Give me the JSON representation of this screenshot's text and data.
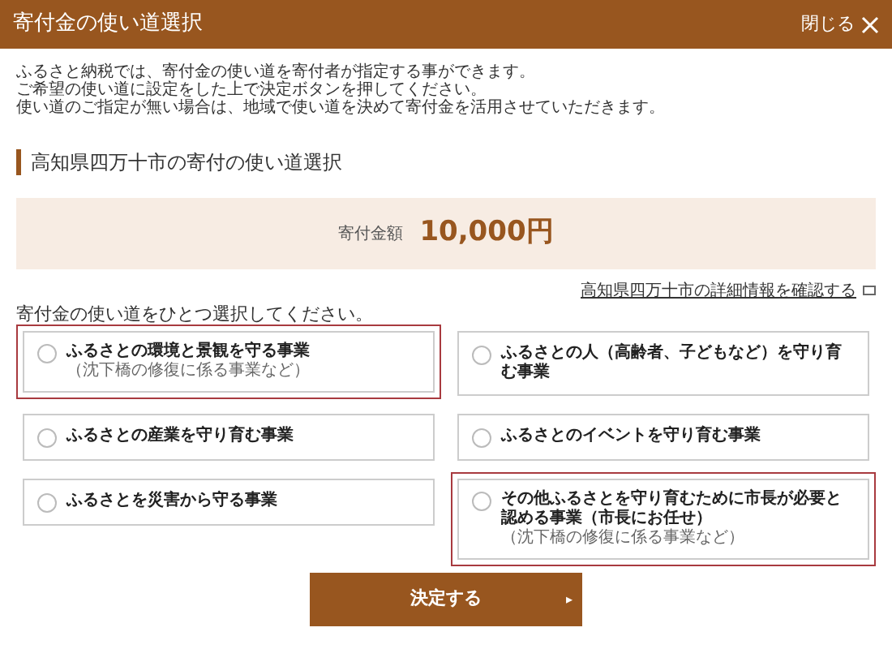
{
  "header": {
    "title": "寄付金の使い道選択",
    "close_label": "閉じる"
  },
  "description": [
    "ふるさと納税では、寄付金の使い道を寄付者が指定する事ができます。",
    "ご希望の使い道に設定をした上で決定ボタンを押してください。",
    "使い道のご指定が無い場合は、地域で使い道を決めて寄付金を活用させていただきます。"
  ],
  "section_title": "高知県四万十市の寄付の使い道選択",
  "amount": {
    "label": "寄付金額",
    "value": "10,000円"
  },
  "detail_link": "高知県四万十市の詳細情報を確認する",
  "prompt": "寄付金の使い道をひとつ選択してください。",
  "options": [
    {
      "label": "ふるさとの環境と景観を守る事業",
      "note": "（沈下橋の修復に係る事業など）",
      "selected": false,
      "highlighted": true
    },
    {
      "label": "ふるさとの人（高齢者、子どもなど）を守り育む事業",
      "selected": false,
      "highlighted": false
    },
    {
      "label": "ふるさとの産業を守り育む事業",
      "selected": false,
      "highlighted": false
    },
    {
      "label": "ふるさとのイベントを守り育む事業",
      "selected": false,
      "highlighted": false
    },
    {
      "label": "ふるさとを災害から守る事業",
      "selected": false,
      "highlighted": false
    },
    {
      "label": "その他ふるさとを守り育むために市長が必要と認める事業（市長にお任せ）",
      "note": "（沈下橋の修復に係る事業など）",
      "selected": false,
      "highlighted": true
    }
  ],
  "submit": {
    "label": "決定する",
    "arrow": "▸"
  }
}
